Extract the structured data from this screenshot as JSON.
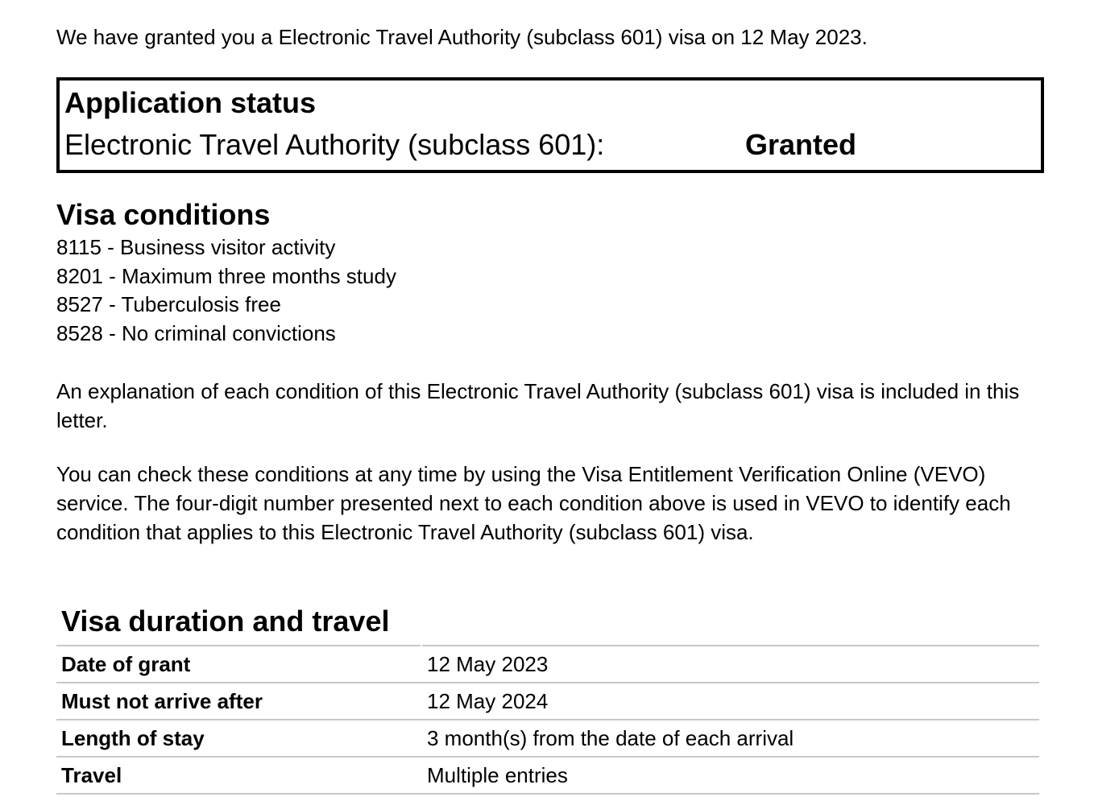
{
  "intro": "We have granted you a Electronic Travel Authority (subclass 601) visa on 12 May 2023.",
  "application_status": {
    "title": "Application status",
    "label": "Electronic Travel Authority (subclass 601):",
    "value": "Granted"
  },
  "visa_conditions": {
    "heading": "Visa conditions",
    "items": [
      "8115 - Business visitor activity",
      "8201 - Maximum three months study",
      "8527 - Tuberculosis free",
      "8528 - No criminal convictions"
    ]
  },
  "paragraphs": {
    "explanation": "An explanation of each condition of this Electronic Travel Authority (subclass 601) visa is included in this letter.",
    "vevo": "You can check these conditions at any time by using the Visa Entitlement Verification Online (VEVO) service. The four-digit number presented next to each condition above is used in VEVO to identify each condition that applies to this Electronic Travel Authority (subclass 601) visa."
  },
  "visa_duration": {
    "heading": "Visa duration and travel",
    "rows": [
      {
        "label": "Date of grant",
        "value": "12 May 2023"
      },
      {
        "label": "Must not arrive after",
        "value": "12 May 2024"
      },
      {
        "label": "Length of stay",
        "value": "3 month(s) from the date of each arrival"
      },
      {
        "label": "Travel",
        "value": "Multiple entries"
      }
    ]
  }
}
